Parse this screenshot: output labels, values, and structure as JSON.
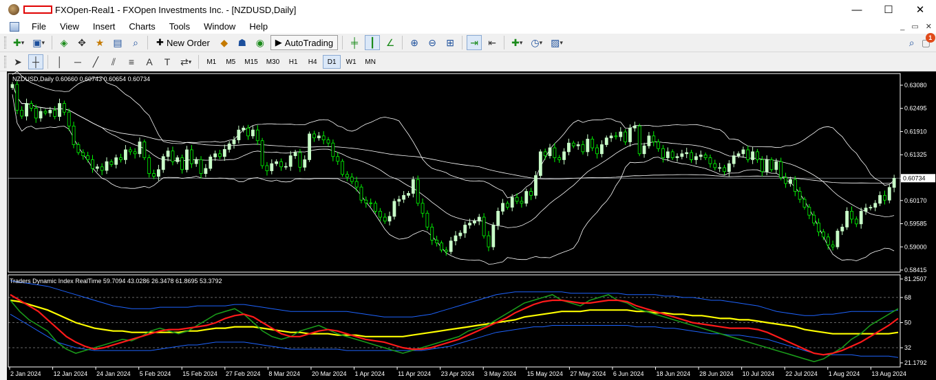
{
  "window": {
    "title": "FXOpen-Real1 - FXOpen Investments Inc. - [NZDUSD,Daily]",
    "minimize": "—",
    "maximize": "☐",
    "close": "✕"
  },
  "menu": [
    "File",
    "View",
    "Insert",
    "Charts",
    "Tools",
    "Window",
    "Help"
  ],
  "mdi": {
    "minimize": "_",
    "restore": "▭",
    "close": "✕"
  },
  "toolbar1": {
    "new_order_label": "New Order",
    "autotrading_label": "AutoTrading",
    "notification_count": "1"
  },
  "timeframes": [
    "M1",
    "M5",
    "M15",
    "M30",
    "H1",
    "H4",
    "D1",
    "W1",
    "MN"
  ],
  "active_timeframe": "D1",
  "chart": {
    "main_label": "NZDUSD,Daily  0.60660 0.60743 0.60654 0.60734",
    "indicator_label": "Traders Dynamic Index RealTime 59.7094 43.0286 26.3478 61.8695 53.3792",
    "current_price": "0.60734",
    "colors": {
      "background": "#000000",
      "bull": "#c8ffc8",
      "bear": "#00ff00",
      "bands": "#ffffff",
      "tdi_blue": "#1e64ff",
      "tdi_green": "#1a9a1a",
      "tdi_red": "#ff1a1a",
      "tdi_yellow": "#ffff00"
    }
  },
  "chart_data": [
    {
      "type": "candlestick",
      "title": "NZDUSD,Daily",
      "price_axis": [
        "0.63080",
        "0.62495",
        "0.61910",
        "0.61325",
        "0.60734",
        "0.60170",
        "0.59585",
        "0.59000",
        "0.58415"
      ],
      "ylim": [
        0.58415,
        0.6308
      ],
      "x_labels": [
        "2 Jan 2024",
        "12 Jan 2024",
        "24 Jan 2024",
        "5 Feb 2024",
        "15 Feb 2024",
        "27 Feb 2024",
        "8 Mar 2024",
        "20 Mar 2024",
        "1 Apr 2024",
        "11 Apr 2024",
        "23 Apr 2024",
        "3 May 2024",
        "15 May 2024",
        "27 May 2024",
        "6 Jun 2024",
        "18 Jun 2024",
        "28 Jun 2024",
        "10 Jul 2024",
        "22 Jul 2024",
        "1 Aug 2024",
        "13 Aug 2024"
      ],
      "close_series": [
        0.631,
        0.6245,
        0.623,
        0.6262,
        0.625,
        0.6225,
        0.6242,
        0.6238,
        0.6245,
        0.6229,
        0.6262,
        0.624,
        0.6205,
        0.6158,
        0.6138,
        0.613,
        0.612,
        0.6098,
        0.6102,
        0.6093,
        0.6115,
        0.6108,
        0.6125,
        0.612,
        0.6145,
        0.614,
        0.6135,
        0.6165,
        0.6125,
        0.6085,
        0.6078,
        0.6095,
        0.6128,
        0.6142,
        0.6115,
        0.6125,
        0.6095,
        0.6145,
        0.611,
        0.612,
        0.6085,
        0.6098,
        0.6127,
        0.6135,
        0.6128,
        0.6146,
        0.616,
        0.617,
        0.6195,
        0.62,
        0.618,
        0.6195,
        0.6168,
        0.6105,
        0.6092,
        0.611,
        0.6115,
        0.6102,
        0.6103,
        0.613,
        0.6138,
        0.6101,
        0.612,
        0.6185,
        0.6175,
        0.618,
        0.617,
        0.6162,
        0.6128,
        0.6116,
        0.6083,
        0.6076,
        0.6065,
        0.6051,
        0.6018,
        0.6011,
        0.601,
        0.599,
        0.5975,
        0.5965,
        0.5977,
        0.6015,
        0.602,
        0.603,
        0.6035,
        0.607,
        0.601,
        0.5985,
        0.595,
        0.5917,
        0.591,
        0.5892,
        0.5888,
        0.5915,
        0.5928,
        0.5935,
        0.5955,
        0.596,
        0.5965,
        0.5975,
        0.5928,
        0.59,
        0.5955,
        0.599,
        0.601,
        0.6,
        0.6025,
        0.6015,
        0.601,
        0.604,
        0.603,
        0.608,
        0.614,
        0.613,
        0.615,
        0.6125,
        0.612,
        0.614,
        0.6162,
        0.6155,
        0.6158,
        0.614,
        0.6172,
        0.615,
        0.6135,
        0.6158,
        0.6175,
        0.618,
        0.6178,
        0.619,
        0.6165,
        0.62,
        0.6205,
        0.6135,
        0.6155,
        0.618,
        0.6165,
        0.6148,
        0.6125,
        0.614,
        0.6125,
        0.6128,
        0.6135,
        0.6138,
        0.612,
        0.6128,
        0.6132,
        0.6125,
        0.611,
        0.61,
        0.61,
        0.609,
        0.611,
        0.613,
        0.6135,
        0.6145,
        0.612,
        0.614,
        0.612,
        0.609,
        0.612,
        0.6095,
        0.6115,
        0.6075,
        0.606,
        0.607,
        0.604,
        0.602,
        0.6,
        0.598,
        0.596,
        0.5938,
        0.5925,
        0.5905,
        0.59,
        0.594,
        0.595,
        0.599,
        0.597,
        0.5958,
        0.599,
        0.5998,
        0.6,
        0.601,
        0.603,
        0.6018,
        0.605,
        0.6073
      ]
    },
    {
      "type": "line",
      "title": "Traders Dynamic Index RealTime",
      "y_axis": [
        "81.2507",
        "68",
        "50",
        "32",
        "21.1792"
      ],
      "ylim": [
        21.1792,
        81.2507
      ],
      "levels": [
        68,
        50,
        32
      ],
      "series": [
        {
          "name": "green",
          "color": "#1a9a1a",
          "values": [
            66,
            58,
            52,
            48,
            44,
            36,
            31,
            28,
            30,
            32,
            34,
            36,
            38,
            37,
            40,
            44,
            46,
            44,
            42,
            44,
            48,
            52,
            56,
            58,
            60,
            56,
            50,
            44,
            40,
            38,
            40,
            44,
            46,
            48,
            45,
            42,
            40,
            38,
            36,
            34,
            32,
            30,
            28,
            30,
            32,
            34,
            36,
            38,
            40,
            44,
            46,
            48,
            52,
            56,
            60,
            64,
            66,
            68,
            70,
            66,
            64,
            62,
            66,
            68,
            70,
            66,
            64,
            60,
            58,
            56,
            54,
            52,
            50,
            48,
            46,
            44,
            42,
            40,
            38,
            36,
            34,
            32,
            30,
            28,
            26,
            24,
            22,
            24,
            28,
            32,
            38,
            42,
            48,
            52,
            56,
            60
          ]
        },
        {
          "name": "red",
          "color": "#ff1a1a",
          "values": [
            70,
            66,
            62,
            58,
            52,
            46,
            40,
            36,
            33,
            31,
            32,
            34,
            36,
            38,
            40,
            42,
            44,
            45,
            45,
            46,
            47,
            48,
            50,
            53,
            55,
            56,
            54,
            50,
            46,
            42,
            40,
            40,
            42,
            44,
            45,
            44,
            42,
            40,
            38,
            37,
            36,
            34,
            32,
            31,
            31,
            32,
            34,
            36,
            38,
            41,
            44,
            47,
            50,
            53,
            57,
            60,
            63,
            65,
            66,
            66,
            65,
            64,
            64,
            65,
            66,
            66,
            65,
            62,
            60,
            58,
            56,
            54,
            52,
            50,
            49,
            48,
            47,
            46,
            46,
            46,
            45,
            43,
            40,
            37,
            34,
            31,
            28,
            27,
            28,
            30,
            33,
            36,
            40,
            44,
            48,
            53
          ]
        },
        {
          "name": "yellow",
          "color": "#ffff00",
          "values": [
            66,
            65,
            63,
            61,
            59,
            56,
            53,
            50,
            48,
            46,
            45,
            44,
            44,
            43,
            43,
            43,
            43,
            43,
            43,
            44,
            44,
            45,
            46,
            46,
            47,
            47,
            47,
            46,
            45,
            44,
            43,
            43,
            42,
            42,
            42,
            41,
            41,
            41,
            40,
            40,
            40,
            40,
            40,
            41,
            42,
            43,
            44,
            45,
            46,
            47,
            48,
            49,
            50,
            51,
            52,
            54,
            55,
            56,
            57,
            58,
            58,
            58,
            59,
            59,
            59,
            59,
            59,
            58,
            58,
            57,
            57,
            56,
            56,
            55,
            55,
            54,
            53,
            53,
            52,
            52,
            51,
            50,
            49,
            48,
            47,
            45,
            44,
            43,
            42,
            42,
            42,
            42,
            42,
            42,
            42,
            43
          ]
        },
        {
          "name": "upper",
          "color": "#1e64ff",
          "values": [
            80,
            79,
            78,
            77,
            76,
            74,
            72,
            70,
            68,
            66,
            64,
            62,
            61,
            60,
            60,
            60,
            61,
            61,
            61,
            61,
            62,
            62,
            62,
            62,
            63,
            63,
            62,
            61,
            60,
            59,
            58,
            58,
            58,
            58,
            58,
            58,
            58,
            57,
            56,
            55,
            54,
            54,
            54,
            54,
            55,
            56,
            58,
            60,
            62,
            64,
            66,
            68,
            70,
            71,
            72,
            72,
            72,
            72,
            72,
            72,
            71,
            71,
            71,
            71,
            71,
            71,
            70,
            70,
            70,
            70,
            69,
            69,
            68,
            68,
            67,
            66,
            66,
            65,
            64,
            63,
            62,
            60,
            58,
            57,
            56,
            55,
            55,
            56,
            56,
            57,
            58,
            58,
            58,
            58,
            58,
            59
          ]
        },
        {
          "name": "lower",
          "color": "#1e64ff",
          "values": [
            56,
            52,
            48,
            44,
            40,
            36,
            34,
            32,
            31,
            30,
            30,
            30,
            30,
            30,
            30,
            30,
            31,
            32,
            33,
            34,
            34,
            35,
            36,
            36,
            36,
            36,
            35,
            34,
            33,
            32,
            31,
            31,
            31,
            31,
            31,
            31,
            30,
            30,
            30,
            30,
            30,
            30,
            30,
            30,
            30,
            31,
            32,
            33,
            35,
            37,
            39,
            41,
            43,
            44,
            45,
            46,
            47,
            47,
            48,
            48,
            48,
            48,
            48,
            48,
            48,
            48,
            48,
            47,
            47,
            47,
            46,
            46,
            45,
            44,
            43,
            42,
            42,
            41,
            41,
            40,
            39,
            38,
            36,
            34,
            32,
            30,
            28,
            27,
            27,
            27,
            27,
            26,
            26,
            26,
            26,
            25
          ]
        }
      ]
    }
  ]
}
